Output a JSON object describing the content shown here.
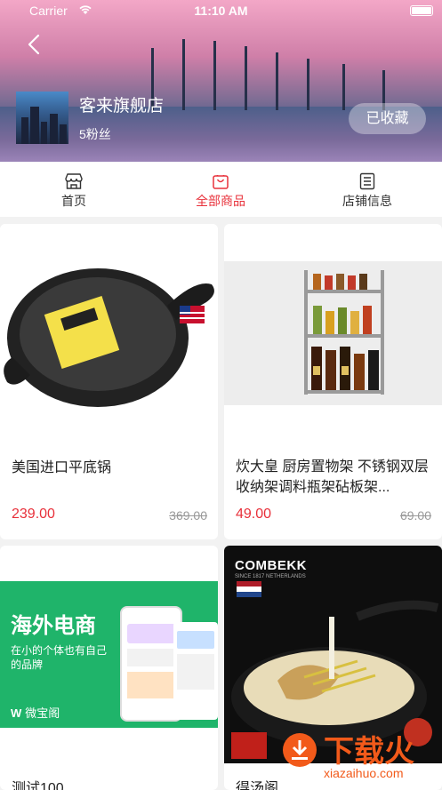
{
  "status_bar": {
    "carrier": "Carrier",
    "time": "11:10 AM"
  },
  "shop": {
    "name": "客来旗舰店",
    "fans": "5粉丝",
    "favorite_label": "已收藏"
  },
  "tabs": [
    {
      "label": "首页",
      "icon": "store-icon"
    },
    {
      "label": "全部商品",
      "icon": "bag-icon",
      "active": true
    },
    {
      "label": "店铺信息",
      "icon": "list-icon"
    }
  ],
  "products": [
    {
      "title": "美国进口平底锅",
      "price": "239.00",
      "original_price": "369.00"
    },
    {
      "title": "炊大皇 厨房置物架 不锈钢双层收纳架调料瓶架砧板架...",
      "price": "49.00",
      "original_price": "69.00"
    },
    {
      "title": "测试100",
      "banner_title": "海外电商",
      "banner_sub": "在小的个体也有自己的品牌",
      "banner_brand": "微宝阁"
    },
    {
      "title": "得汤阁",
      "brand": "COMBEKK",
      "brand_sub": "SINCE 1817 NETHERLANDS"
    }
  ],
  "watermark": {
    "text": "下载火",
    "url": "xiazaihuo.com"
  },
  "colors": {
    "accent": "#e8303a",
    "background": "#f2f2f2",
    "banner_green": "#1fb46a"
  }
}
